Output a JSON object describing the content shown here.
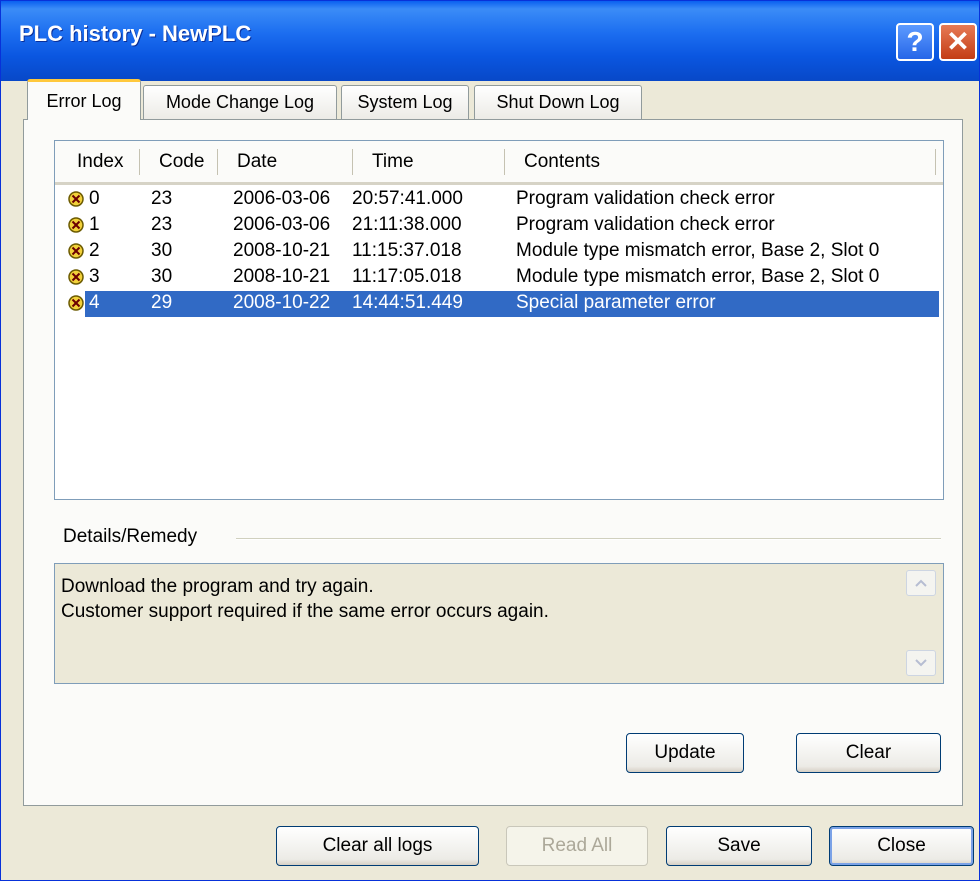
{
  "window": {
    "title": "PLC history - NewPLC",
    "help_label": "?",
    "close_label": "✕"
  },
  "tabs": [
    {
      "label": "Error Log",
      "active": true
    },
    {
      "label": "Mode Change Log",
      "active": false
    },
    {
      "label": "System Log",
      "active": false
    },
    {
      "label": "Shut Down Log",
      "active": false
    }
  ],
  "log_table": {
    "columns": [
      "Index",
      "Code",
      "Date",
      "Time",
      "Contents"
    ],
    "rows": [
      {
        "index": "0",
        "code": "23",
        "date": "2006-03-06",
        "time": "20:57:41.000",
        "contents": "Program validation check error",
        "icon": "error-icon",
        "selected": false
      },
      {
        "index": "1",
        "code": "23",
        "date": "2006-03-06",
        "time": "21:11:38.000",
        "contents": "Program validation check error",
        "icon": "error-icon",
        "selected": false
      },
      {
        "index": "2",
        "code": "30",
        "date": "2008-10-21",
        "time": "11:15:37.018",
        "contents": "Module type mismatch error, Base 2, Slot 0",
        "icon": "error-icon",
        "selected": false
      },
      {
        "index": "3",
        "code": "30",
        "date": "2008-10-21",
        "time": "11:17:05.018",
        "contents": "Module type mismatch error, Base 2, Slot 0",
        "icon": "error-icon",
        "selected": false
      },
      {
        "index": "4",
        "code": "29",
        "date": "2008-10-22",
        "time": "14:44:51.449",
        "contents": "Special parameter error",
        "icon": "error-icon",
        "selected": true
      }
    ]
  },
  "details": {
    "label": "Details/Remedy",
    "lines": [
      "Download the program and try again.",
      "Customer support required if the same error occurs again."
    ]
  },
  "panel_buttons": {
    "update": "Update",
    "clear": "Clear"
  },
  "footer_buttons": {
    "clear_all": "Clear all logs",
    "read_all": "Read All",
    "save": "Save",
    "close": "Close"
  },
  "colors": {
    "selection": "#316ac5",
    "title_bar": "#0a56e0",
    "error_icon": "#c8a000"
  }
}
